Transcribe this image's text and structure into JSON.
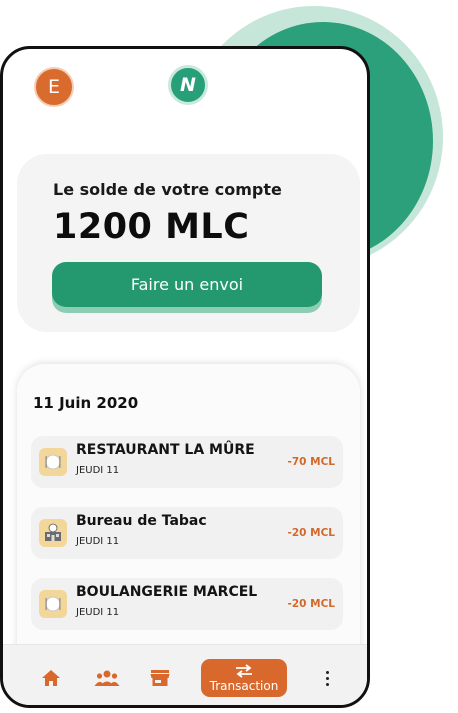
{
  "header": {
    "avatar_initial": "E",
    "logo_letter": "N"
  },
  "balance": {
    "caption": "Le solde de votre compte",
    "amount": "1200 MLC",
    "send_label": "Faire un envoi"
  },
  "transactions": {
    "date": "11 Juin 2020",
    "items": [
      {
        "name": "RESTAURANT LA MÛRE",
        "day": "JEUDI 11",
        "amount": "-70 MCL",
        "icon": "restaurant-icon"
      },
      {
        "name": "Bureau de Tabac",
        "day": "JEUDI 11",
        "amount": "-20 MCL",
        "icon": "store-24h-icon"
      },
      {
        "name": "BOULANGERIE MARCEL",
        "day": "JEUDI 11",
        "amount": "-20 MCL",
        "icon": "restaurant-icon"
      }
    ]
  },
  "bottom_nav": {
    "items": [
      "home-icon",
      "people-icon",
      "store-icon",
      "transaction-icon",
      "more-vertical-icon"
    ],
    "active_label": "Transaction"
  },
  "colors": {
    "brand_green": "#24986f",
    "accent_orange": "#d8682b",
    "icon_bg": "#f3d79a"
  }
}
